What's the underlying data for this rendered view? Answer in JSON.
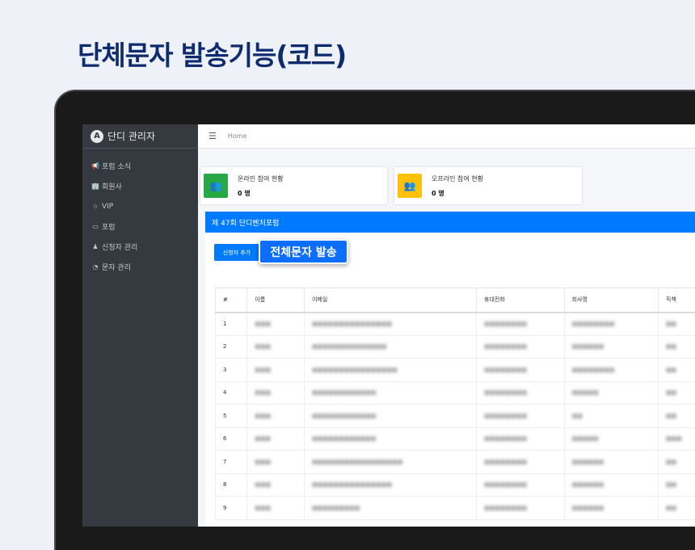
{
  "page_title": "단체문자 발송기능(코드)",
  "sidebar": {
    "brand_logo": "A",
    "brand": "단디 관리자",
    "items": [
      {
        "icon": "megaphone-icon",
        "glyph": "📢",
        "label": "포럼 소식"
      },
      {
        "icon": "company-icon",
        "glyph": "🏢",
        "label": "회원사"
      },
      {
        "icon": "star-icon",
        "glyph": "☆",
        "label": "VIP"
      },
      {
        "icon": "forum-icon",
        "glyph": "▭",
        "label": "포럼"
      },
      {
        "icon": "person-icon",
        "glyph": "♟",
        "label": "신청자 관리"
      },
      {
        "icon": "message-icon",
        "glyph": "◔",
        "label": "문자 관리"
      }
    ]
  },
  "topbar": {
    "menu_glyph": "☰",
    "breadcrumb": "Home"
  },
  "stats": [
    {
      "label": "온라인 참여 현황",
      "value": "0 명",
      "color": "#28a745",
      "icon": "users-icon"
    },
    {
      "label": "오프라인 참여 현황",
      "value": "0 명",
      "color": "#ffc107",
      "icon": "users-icon"
    }
  ],
  "card": {
    "title": "제 47회 단디벤처포럼",
    "add_button": "신청자 추가",
    "sms_button": "전체문자 발송"
  },
  "table": {
    "headers": [
      "#",
      "이름",
      "이메일",
      "휴대전화",
      "회사명",
      "직책"
    ],
    "rows": [
      [
        "1",
        "■■■",
        "■■■■■■■■■■■■■■■",
        "■■■■■■■■",
        "■■■■■■■■",
        "■■"
      ],
      [
        "2",
        "■■■",
        "■■■■■■■■■■■■■■",
        "■■■■■■■■",
        "■■■■■■",
        "■■"
      ],
      [
        "3",
        "■■■",
        "■■■■■■■■■■■■■■■■",
        "■■■■■■■■",
        "■■■■■■■■",
        "■■"
      ],
      [
        "4",
        "■■■",
        "■■■■■■■■■■■■",
        "■■■■■■■■",
        "■■■■■",
        "■■"
      ],
      [
        "5",
        "■■■",
        "■■■■■■■■■■■■",
        "■■■■■■■■",
        "■■",
        "■■"
      ],
      [
        "6",
        "■■■",
        "■■■■■■■■■■■■",
        "■■■■■■■■",
        "■■■■■",
        "■■■"
      ],
      [
        "7",
        "■■■",
        "■■■■■■■■■■■■■■■■■",
        "■■■■■■■■",
        "■■■■■■",
        "■■"
      ],
      [
        "8",
        "■■■",
        "■■■■■■■■■■■■■■■",
        "■■■■■■■■",
        "■■■■■■",
        "■■"
      ],
      [
        "9",
        "■■■",
        "■■■■■■■■■",
        "■■■■■■■■",
        "■■■■■■",
        "■■"
      ]
    ]
  }
}
